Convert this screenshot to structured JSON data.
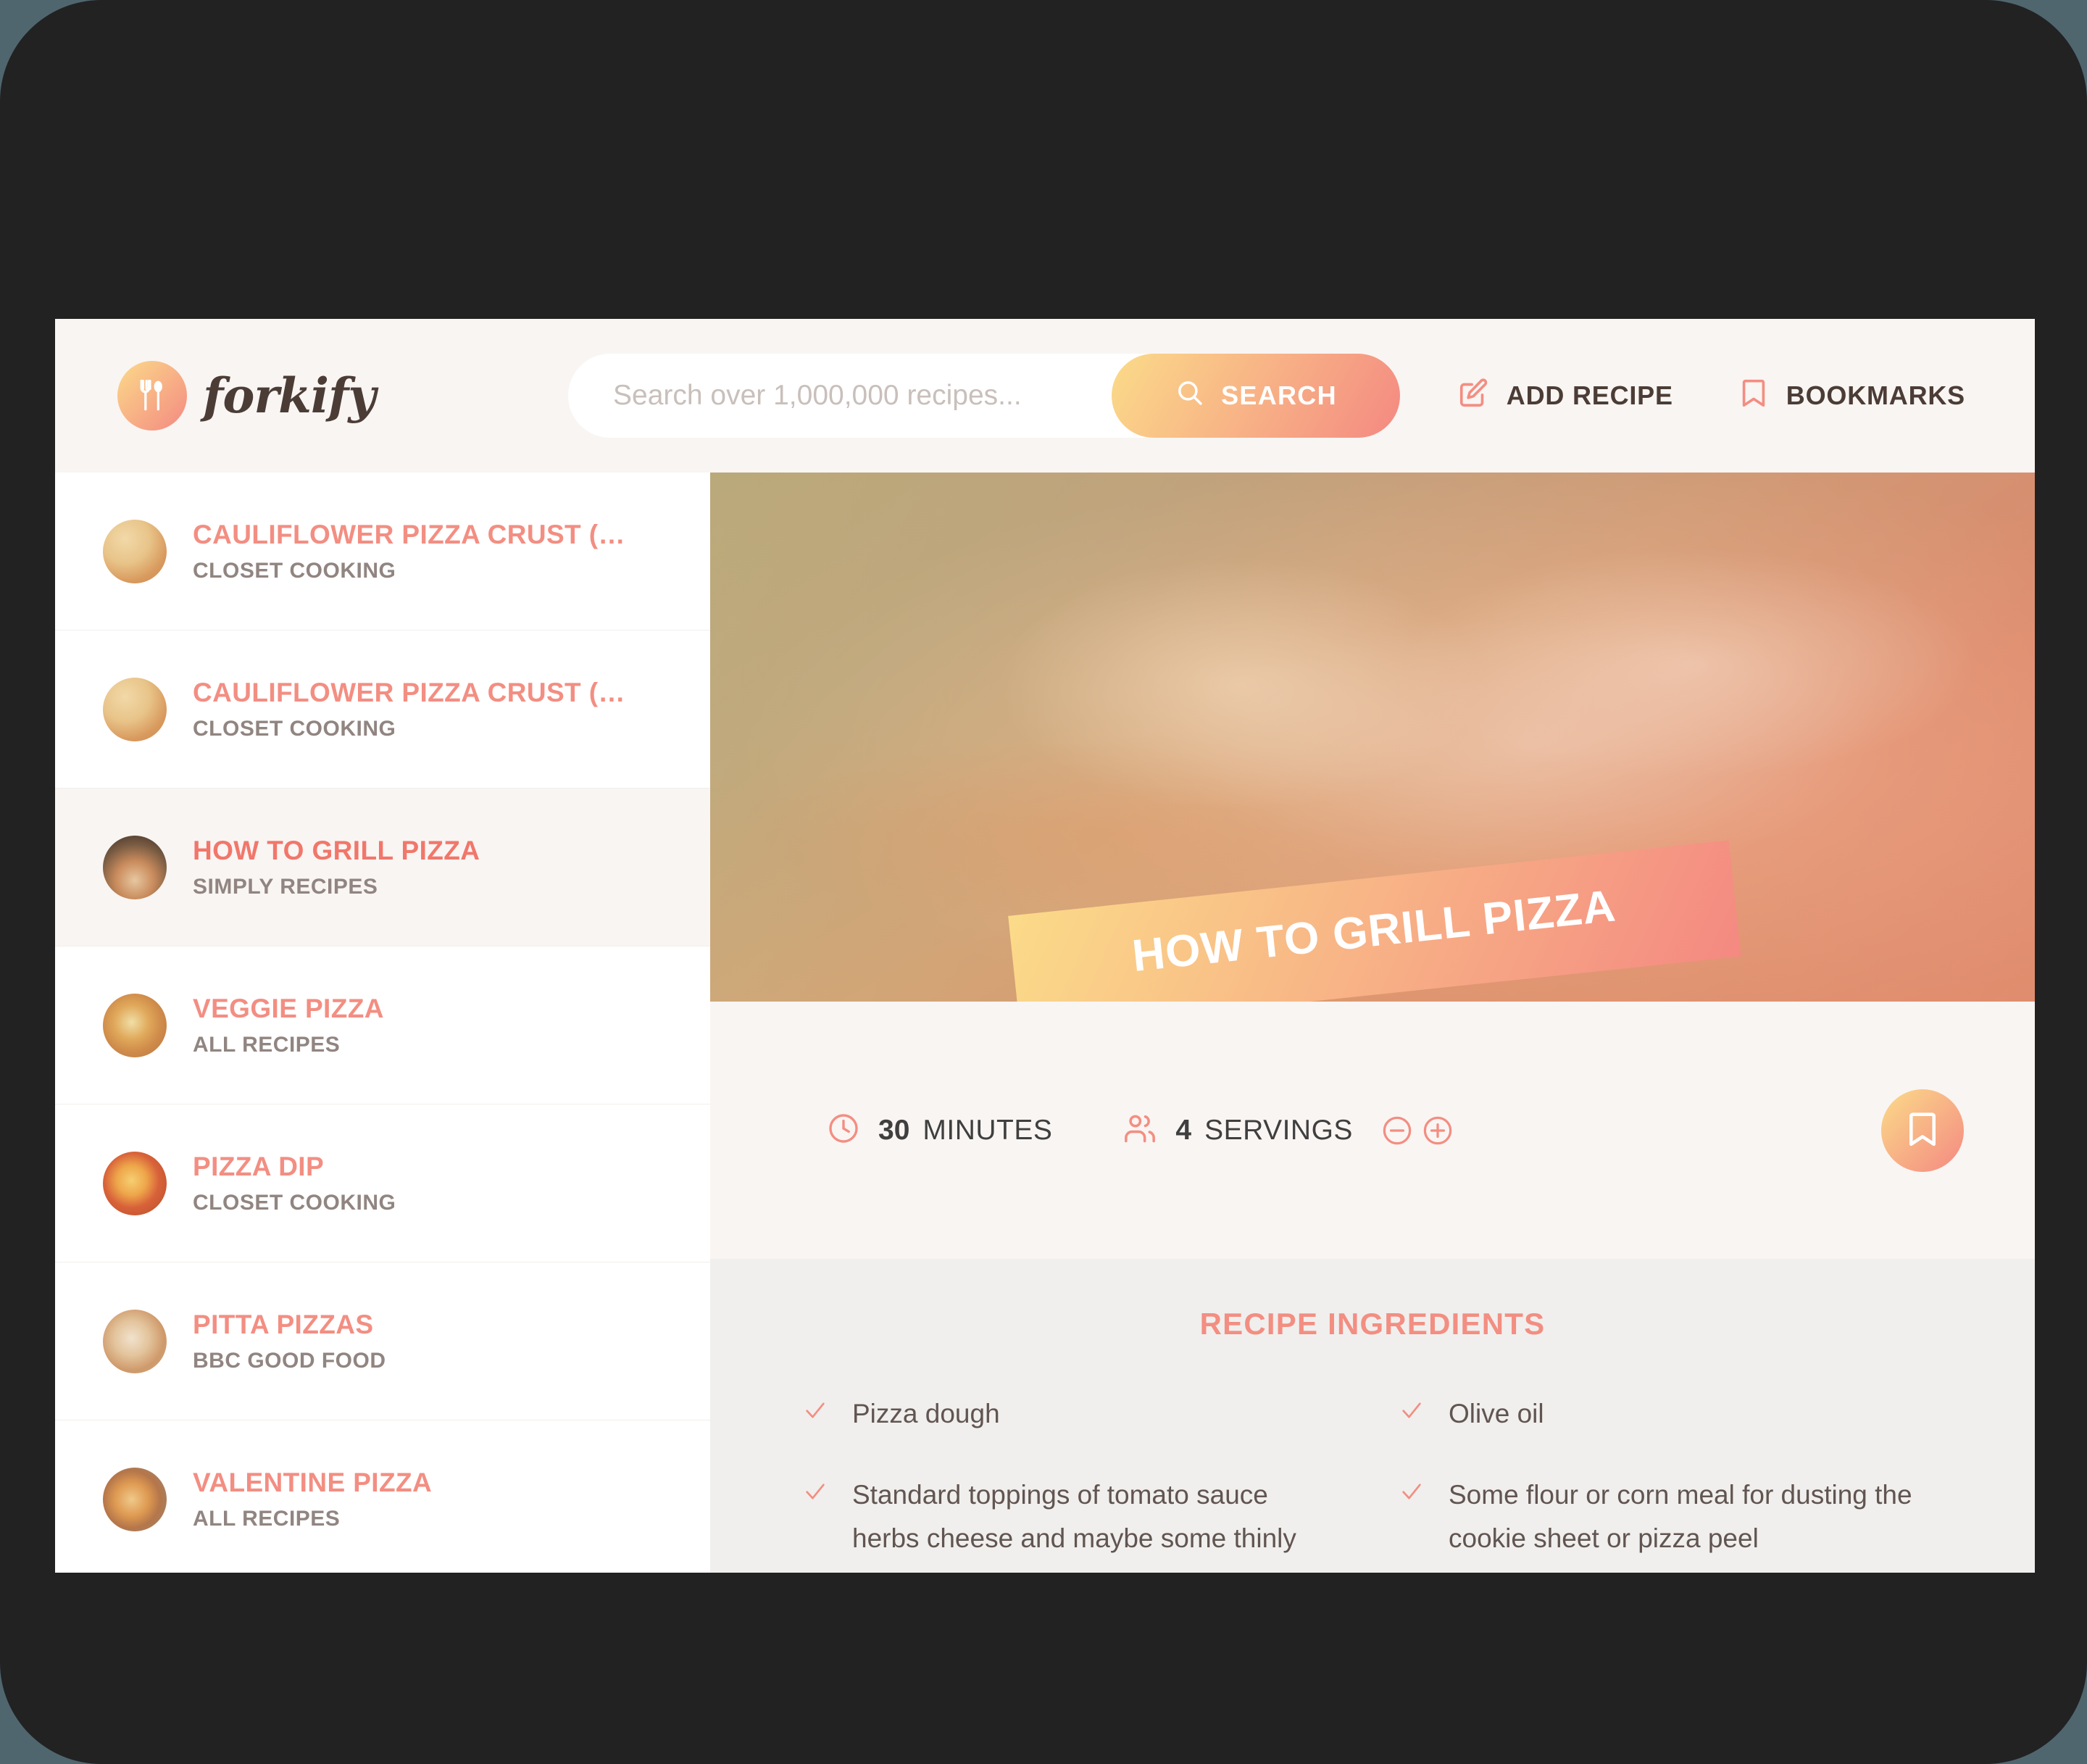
{
  "brand": {
    "name": "forkify",
    "logo_icon": "fork-spoon-icon",
    "gradient_start": "#fbdb89",
    "gradient_end": "#f48982"
  },
  "header": {
    "search": {
      "placeholder": "Search over 1,000,000 recipes...",
      "value": "",
      "button_label": "SEARCH",
      "button_icon": "search-icon"
    },
    "nav": [
      {
        "label": "ADD RECIPE",
        "icon": "edit-square-icon"
      },
      {
        "label": "BOOKMARKS",
        "icon": "bookmark-icon"
      }
    ]
  },
  "results": [
    {
      "title": "CAULIFLOWER PIZZA CRUST (WIT...",
      "publisher": "CLOSET COOKING",
      "active": false
    },
    {
      "title": "CAULIFLOWER PIZZA CRUST (WIT...",
      "publisher": "CLOSET COOKING",
      "active": false
    },
    {
      "title": "HOW TO GRILL PIZZA",
      "publisher": "SIMPLY RECIPES",
      "active": true
    },
    {
      "title": "VEGGIE PIZZA",
      "publisher": "ALL RECIPES",
      "active": false
    },
    {
      "title": "PIZZA DIP",
      "publisher": "CLOSET COOKING",
      "active": false
    },
    {
      "title": "PITTA PIZZAS",
      "publisher": "BBC GOOD FOOD",
      "active": false
    },
    {
      "title": "VALENTINE PIZZA",
      "publisher": "ALL RECIPES",
      "active": false
    }
  ],
  "recipe": {
    "title": "HOW TO GRILL PIZZA",
    "time_value": "30",
    "time_unit": "MINUTES",
    "time_icon": "clock-icon",
    "servings_value": "4",
    "servings_unit": "SERVINGS",
    "servings_icon": "users-icon",
    "decrease_icon": "minus-circle-icon",
    "increase_icon": "plus-circle-icon",
    "bookmark_icon": "bookmark-icon",
    "ingredients_heading": "RECIPE INGREDIENTS",
    "ingredients": [
      "Pizza dough",
      "Olive oil",
      "Standard toppings of tomato sauce herbs cheese and maybe some thinly",
      "Some flour or corn meal for dusting the cookie sheet or pizza peel"
    ]
  },
  "colors": {
    "accent": "#f38e82",
    "accent_dark": "#f1776b",
    "text_dark": "#615551",
    "panel_light": "#f9f5f3",
    "ingredients_bg": "#f0efed",
    "frame": "#222222",
    "desktop": "#50666f"
  }
}
